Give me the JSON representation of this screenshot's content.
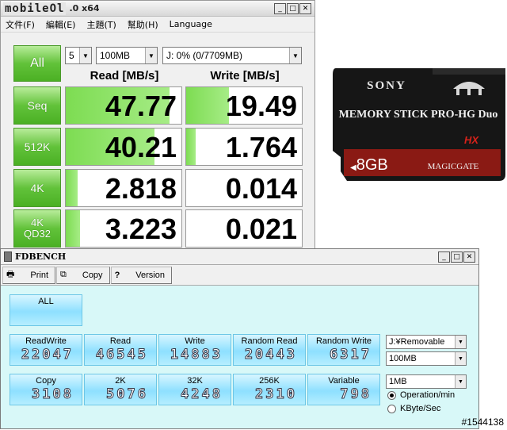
{
  "cdm": {
    "logo": "mobileOl",
    "title": ".0 x64",
    "menu": [
      "文件(F)",
      "編輯(E)",
      "主題(T)",
      "幫助(H)",
      "Language"
    ],
    "all_label": "All",
    "runs": "5",
    "size": "100MB",
    "drive": "J: 0% (0/7709MB)",
    "read_header": "Read [MB/s]",
    "write_header": "Write [MB/s]",
    "rows": [
      {
        "label": "Seq",
        "label2": "",
        "read": "47.77",
        "write": "19.49",
        "read_level": 0.9,
        "write_level": 0.37
      },
      {
        "label": "512K",
        "label2": "",
        "read": "40.21",
        "write": "1.764",
        "read_level": 0.77,
        "write_level": 0.08
      },
      {
        "label": "4K",
        "label2": "",
        "read": "2.818",
        "write": "0.014",
        "read_level": 0.1,
        "write_level": 0.0
      },
      {
        "label": "4K",
        "label2": "QD32",
        "read": "3.223",
        "write": "0.021",
        "read_level": 0.12,
        "write_level": 0.0
      }
    ]
  },
  "stick": {
    "brand": "SONY",
    "model": "MEMORY STICK PRO-HG Duo",
    "hx": "HX",
    "capacity": "8GB",
    "magicgate": "MAGICGATE"
  },
  "fd": {
    "title": "FDBENCH",
    "toolbar": [
      "Print",
      "Copy",
      "Version"
    ],
    "all_label": "ALL",
    "row1": [
      {
        "label": "ReadWrite",
        "value": "22047"
      },
      {
        "label": "Read",
        "value": "46545"
      },
      {
        "label": "Write",
        "value": "14883"
      },
      {
        "label": "Random Read",
        "value": "20443"
      },
      {
        "label": "Random Write",
        "value": "6317"
      }
    ],
    "row2": [
      {
        "label": "Copy",
        "value": "3108"
      },
      {
        "label": "2K",
        "value": "5076"
      },
      {
        "label": "32K",
        "value": "4248"
      },
      {
        "label": "256K",
        "value": "2310"
      },
      {
        "label": "Variable",
        "value": "798"
      }
    ],
    "drive_select": "J:¥Removable",
    "size_select": "100MB",
    "block_select": "1MB",
    "radio1": "Operation/min",
    "radio2": "KByte/Sec",
    "radio_selected": 1
  },
  "tag": "#1544138",
  "colors": {
    "green": "#62c23a",
    "cyan": "#8ee0ff",
    "fd_bg": "#d8f8f8"
  }
}
